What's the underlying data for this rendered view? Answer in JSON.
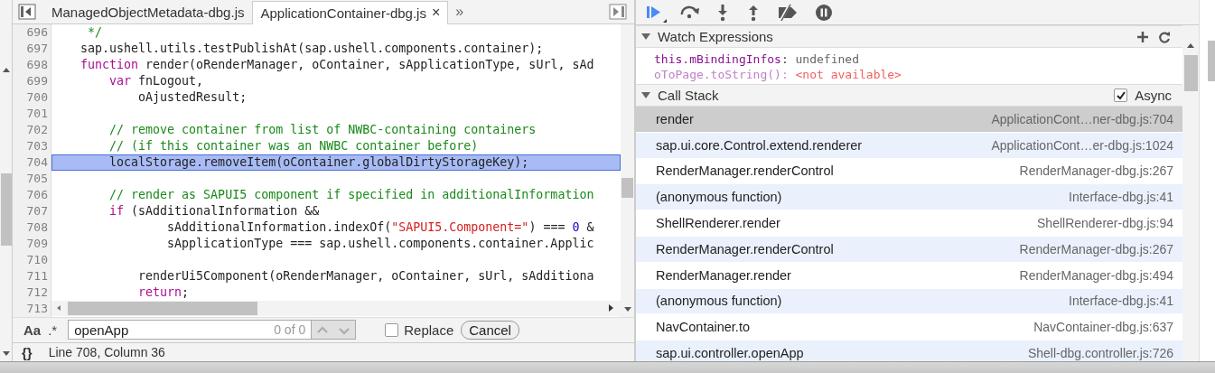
{
  "tabs": [
    {
      "label": "ManagedObjectMetadata-dbg.js",
      "selected": false
    },
    {
      "label": "ApplicationContainer-dbg.js",
      "selected": true,
      "close": "×"
    }
  ],
  "more_tabs": "»",
  "code_lines": [
    {
      "number": "696",
      "highlighted": false,
      "segments": [
        {
          "kind": "comment",
          "text": "     */"
        }
      ]
    },
    {
      "number": "697",
      "highlighted": false,
      "segments": [
        {
          "kind": "plain",
          "text": "    sap.ushell.utils.testPublishAt(sap.ushell.components.container);"
        }
      ]
    },
    {
      "number": "698",
      "highlighted": false,
      "segments": [
        {
          "kind": "keyword",
          "text": "    function"
        },
        {
          "kind": "plain",
          "text": " render(oRenderManager, oContainer, sApplicationType, sUrl, sAd"
        }
      ]
    },
    {
      "number": "699",
      "highlighted": false,
      "segments": [
        {
          "kind": "keyword",
          "text": "        var"
        },
        {
          "kind": "plain",
          "text": " fnLogout,"
        }
      ]
    },
    {
      "number": "700",
      "highlighted": false,
      "segments": [
        {
          "kind": "plain",
          "text": "            oAjustedResult;"
        }
      ]
    },
    {
      "number": "701",
      "highlighted": false
    },
    {
      "number": "702",
      "highlighted": false,
      "segments": [
        {
          "kind": "comment",
          "text": "        // remove container from list of NWBC-containing containers"
        }
      ]
    },
    {
      "number": "703",
      "highlighted": false,
      "segments": [
        {
          "kind": "comment",
          "text": "        // (if this container was an NWBC container before)"
        }
      ]
    },
    {
      "number": "704",
      "highlighted": true,
      "segments": [
        {
          "kind": "plain",
          "text": "        localStorage.removeItem(oContainer.globalDirtyStorageKey);"
        }
      ]
    },
    {
      "number": "705",
      "highlighted": false
    },
    {
      "number": "706",
      "highlighted": false,
      "segments": [
        {
          "kind": "comment",
          "text": "        // render as SAPUI5 component if specified in additionalInformation"
        }
      ]
    },
    {
      "number": "707",
      "highlighted": false,
      "segments": [
        {
          "kind": "keyword",
          "text": "        if"
        },
        {
          "kind": "plain",
          "text": " (sAdditionalInformation &&"
        }
      ]
    },
    {
      "number": "708",
      "highlighted": false,
      "segments": [
        {
          "kind": "plain",
          "text": "                sAdditionalInformation.indexOf("
        },
        {
          "kind": "string",
          "text": "\"SAPUI5.Component=\""
        },
        {
          "kind": "plain",
          "text": ") === "
        },
        {
          "kind": "number",
          "text": "0"
        },
        {
          "kind": "plain",
          "text": " &"
        }
      ]
    },
    {
      "number": "709",
      "highlighted": false,
      "segments": [
        {
          "kind": "plain",
          "text": "                sApplicationType === sap.ushell.components.container.Applic"
        }
      ]
    },
    {
      "number": "710",
      "highlighted": false
    },
    {
      "number": "711",
      "highlighted": false,
      "segments": [
        {
          "kind": "plain",
          "text": "            renderUi5Component(oRenderManager, oContainer, sUrl, sAdditiona"
        }
      ]
    },
    {
      "number": "712",
      "highlighted": false,
      "segments": [
        {
          "kind": "keyword",
          "text": "            return"
        },
        {
          "kind": "plain",
          "text": ";"
        }
      ]
    }
  ],
  "last_line_number": "713",
  "search": {
    "case_toggle": "Aa",
    "regex_toggle": ".*",
    "value": "openApp",
    "count": "0 of 0",
    "replace_label": "Replace",
    "replace_checked": false,
    "cancel": "Cancel"
  },
  "status_bar": {
    "format_icon": "{}",
    "position": "Line 708, Column 36"
  },
  "watch": {
    "title": "Watch Expressions",
    "items": [
      {
        "name": "this.mBindingInfos",
        "separator": ":",
        "value": "undefined",
        "kind": "value"
      },
      {
        "name": "oToPage.toString()",
        "separator": ":",
        "value": "<not available>",
        "kind": "error"
      }
    ]
  },
  "call_stack": {
    "title": "Call Stack",
    "async_label": "Async",
    "async_checked": true,
    "frames": [
      {
        "function": "render",
        "location": "ApplicationCont…ner-dbg.js:704",
        "selected": true
      },
      {
        "function": "sap.ui.core.Control.extend.renderer",
        "location": "ApplicationCont…er-dbg.js:1024",
        "selected": false
      },
      {
        "function": "RenderManager.renderControl",
        "location": "RenderManager-dbg.js:267",
        "selected": false
      },
      {
        "function": "(anonymous function)",
        "location": "Interface-dbg.js:41",
        "selected": false
      },
      {
        "function": "ShellRenderer.render",
        "location": "ShellRenderer-dbg.js:94",
        "selected": false
      },
      {
        "function": "RenderManager.renderControl",
        "location": "RenderManager-dbg.js:267",
        "selected": false
      },
      {
        "function": "RenderManager.render",
        "location": "RenderManager-dbg.js:494",
        "selected": false
      },
      {
        "function": "(anonymous function)",
        "location": "Interface-dbg.js:41",
        "selected": false
      },
      {
        "function": "NavContainer.to",
        "location": "NavContainer-dbg.js:637",
        "selected": false
      },
      {
        "function": "sap.ui.controller.openApp",
        "location": "Shell-dbg.controller.js:726",
        "selected": false
      }
    ]
  }
}
